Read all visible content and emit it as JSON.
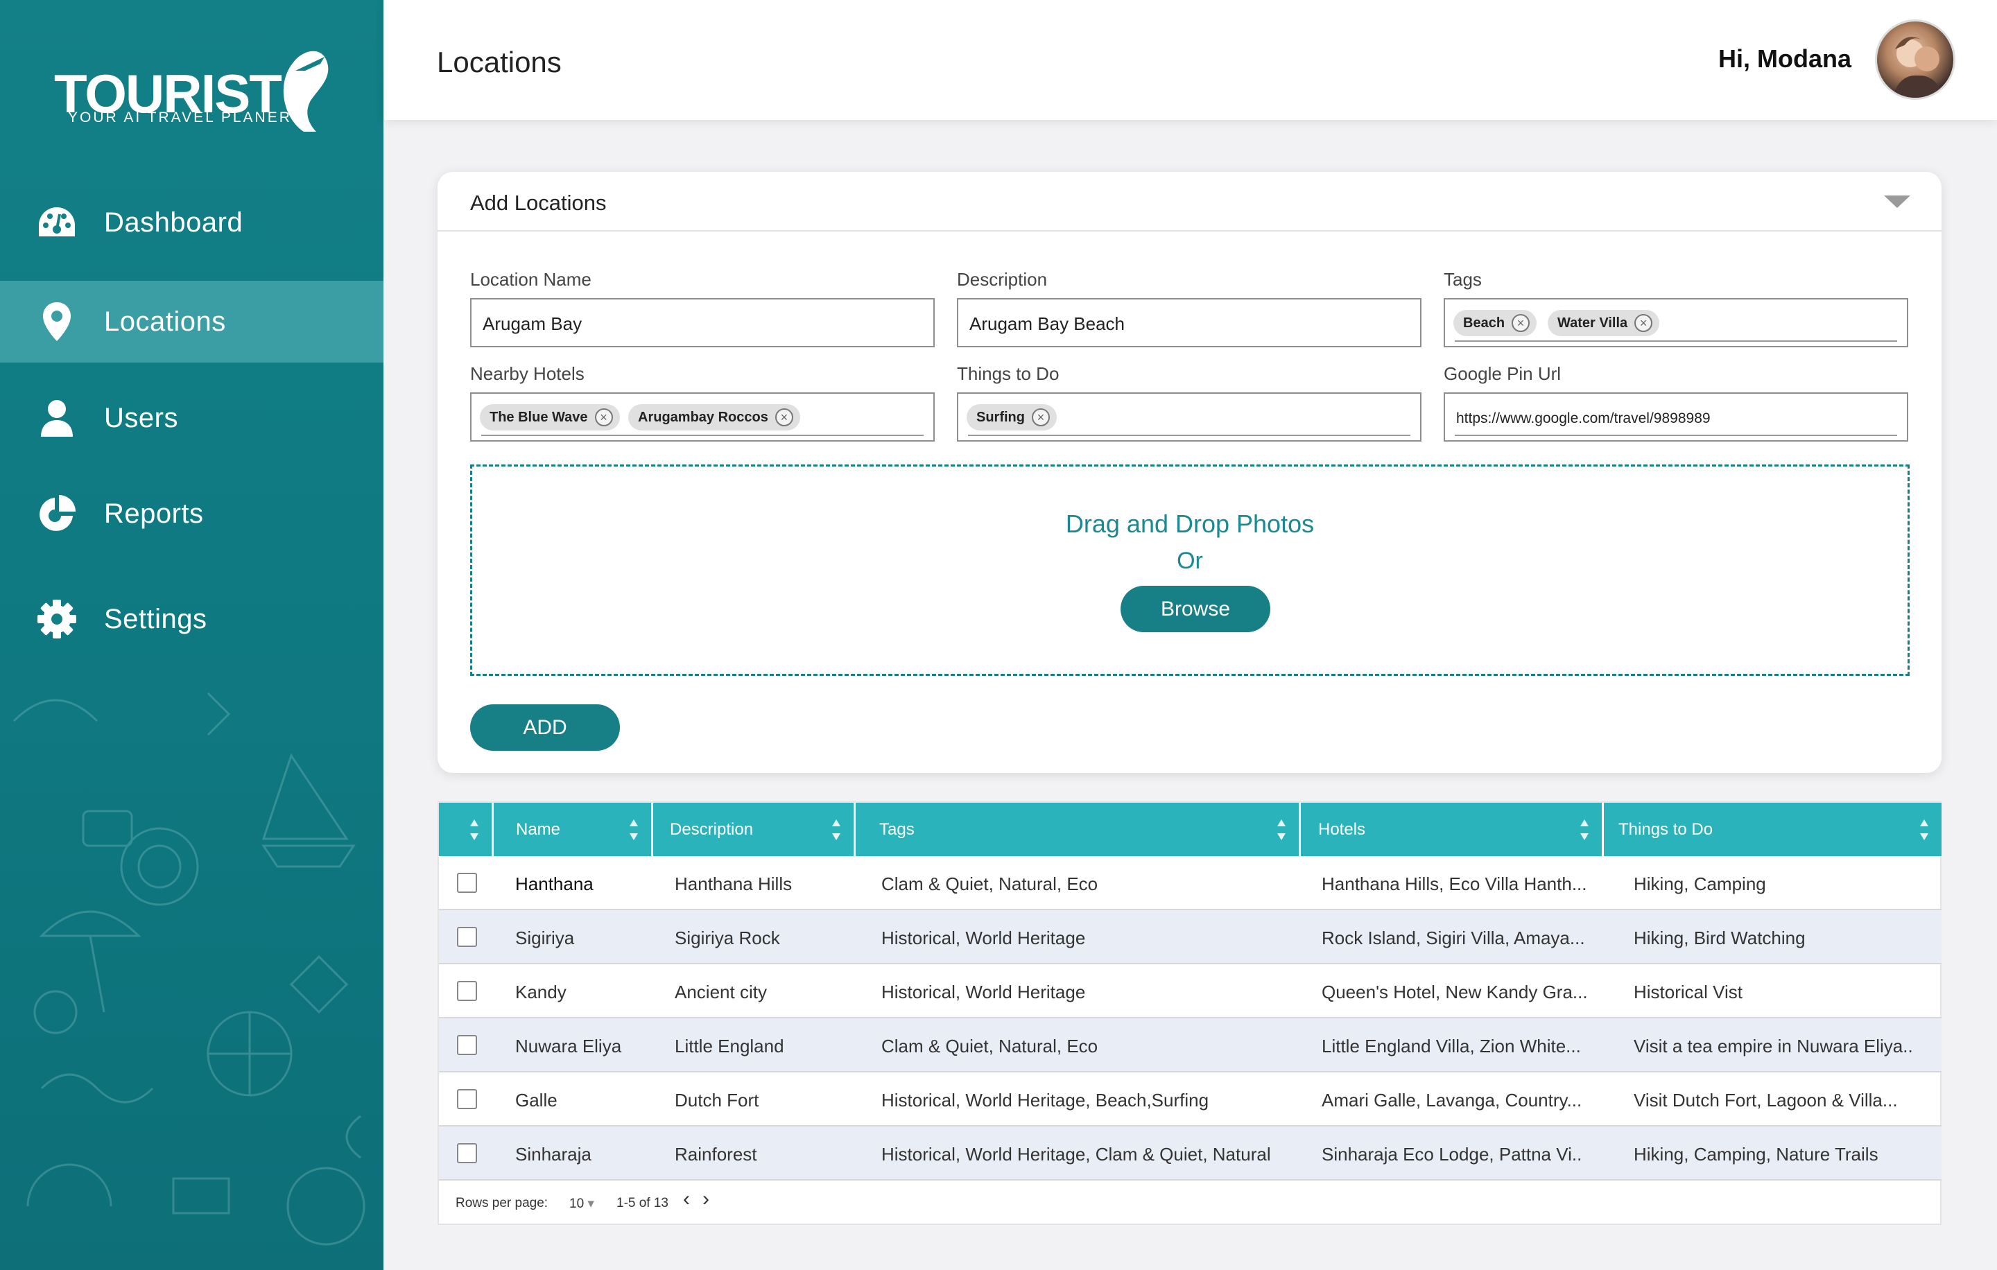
{
  "brand": {
    "name": "TOURIST",
    "tagline": "YOUR AI TRAVEL PLANER",
    "color": "#137f86",
    "accent": "#2ab3bb"
  },
  "sidebar": {
    "items": [
      {
        "label": "Dashboard",
        "icon": "dashboard-icon"
      },
      {
        "label": "Locations",
        "icon": "location-pin-icon",
        "active": true
      },
      {
        "label": "Users",
        "icon": "user-icon"
      },
      {
        "label": "Reports",
        "icon": "pie-chart-icon"
      },
      {
        "label": "Settings",
        "icon": "gear-icon"
      }
    ]
  },
  "header": {
    "title": "Locations",
    "greeting": "Hi, Modana"
  },
  "form": {
    "title": "Add Locations",
    "location_name": {
      "label": "Location Name",
      "value": "Arugam Bay"
    },
    "description": {
      "label": "Description",
      "value": "Arugam Bay Beach"
    },
    "tags": {
      "label": "Tags",
      "chips": [
        "Beach",
        "Water Villa"
      ]
    },
    "nearby_hotels": {
      "label": "Nearby Hotels",
      "chips": [
        "The Blue Wave",
        "Arugambay  Roccos"
      ]
    },
    "things_to_do": {
      "label": "Things to Do",
      "chips": [
        "Surfing"
      ]
    },
    "google_pin": {
      "label": "Google Pin Url",
      "value": "https://www.google.com/travel/9898989"
    },
    "dropzone": {
      "title": "Drag and Drop Photos",
      "or": "Or",
      "browse": "Browse"
    },
    "add_button": "ADD"
  },
  "table": {
    "columns": [
      "Name",
      "Description",
      "Tags",
      "Hotels",
      "Things to Do"
    ],
    "rows": [
      {
        "name": "Hanthana",
        "description": "Hanthana Hills",
        "tags": "Clam & Quiet, Natural, Eco",
        "hotels": "Hanthana Hills, Eco Villa Hanth...",
        "todo": "Hiking, Camping"
      },
      {
        "name": "Sigiriya",
        "description": "Sigiriya Rock",
        "tags": "Historical, World Heritage",
        "hotels": "Rock Island, Sigiri Villa, Amaya...",
        "todo": "Hiking, Bird Watching"
      },
      {
        "name": "Kandy",
        "description": "Ancient city",
        "tags": "Historical, World Heritage",
        "hotels": "Queen's Hotel, New Kandy Gra...",
        "todo": "Historical Vist"
      },
      {
        "name": "Nuwara Eliya",
        "description": "Little England",
        "tags": "Clam & Quiet, Natural, Eco",
        "hotels": "Little England Villa, Zion White...",
        "todo": "Visit a tea empire in Nuwara Eliya.."
      },
      {
        "name": "Galle",
        "description": "Dutch Fort",
        "tags": "Historical, World Heritage, Beach,Surfing",
        "hotels": "Amari Galle, Lavanga, Country...",
        "todo": "Visit Dutch Fort, Lagoon & Villa..."
      },
      {
        "name": "Sinharaja",
        "description": "Rainforest",
        "tags": "Historical, World Heritage, Clam & Quiet, Natural",
        "hotels": "Sinharaja Eco Lodge, Pattna Vi..",
        "todo": "Hiking, Camping, Nature Trails"
      }
    ],
    "footer": {
      "rows_label": "Rows per page:",
      "rows_value": "10",
      "range": "1-5 of 13",
      "prev": "‹",
      "next": "›"
    }
  }
}
